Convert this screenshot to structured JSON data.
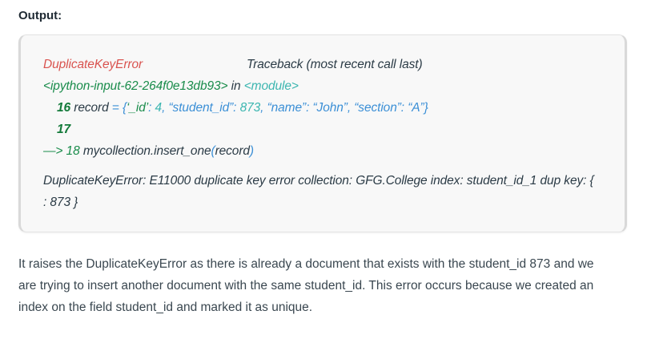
{
  "output_label": "Output:",
  "code": {
    "line1_error_name": "DuplicateKeyError",
    "line1_traceback": "Traceback (most recent call last)",
    "line2_input": "<ipython-input-62-264f0e13db93>",
    "line2_in": " in ",
    "line2_module": "<module>",
    "line3_num": "16",
    "line3_record": " record ",
    "line3_assign": "= {",
    "line3_key1": "‘_id’",
    "line3_colon1": ": ",
    "line3_val1": "4",
    "line3_sep1": ", ",
    "line3_key2": "“student_id”",
    "line3_colon2": ": ",
    "line3_val2": "873",
    "line3_sep2": ", ",
    "line3_key3": "“name”",
    "line3_colon3": ": ",
    "line3_val3": "“John”",
    "line3_sep3": ", ",
    "line3_key4": "“section”",
    "line3_colon4": ": ",
    "line3_val4": "“A”",
    "line3_close": "}",
    "line4_num": "17",
    "line5_arrow": "—> 18",
    "line5_call": " mycollection.insert_one",
    "line5_paren_open": "(",
    "line5_arg": "record",
    "line5_paren_close": ")",
    "line6": "DuplicateKeyError: E11000 duplicate key error collection: GFG.College index: student_id_1 dup key: {",
    "line7": ": 873 }"
  },
  "description": {
    "line1": "It raises the DuplicateKeyError as there is already a document that exists with the student_id 873 and we",
    "line2": "are trying to insert another document with the same student_id. This error occurs because we created an",
    "line3": "index on the field student_id and marked it as unique."
  },
  "colors": {
    "error_red": "#d9534f",
    "green": "#1a8c4b",
    "teal": "#3cb6b0",
    "blue": "#3b8fd6"
  }
}
